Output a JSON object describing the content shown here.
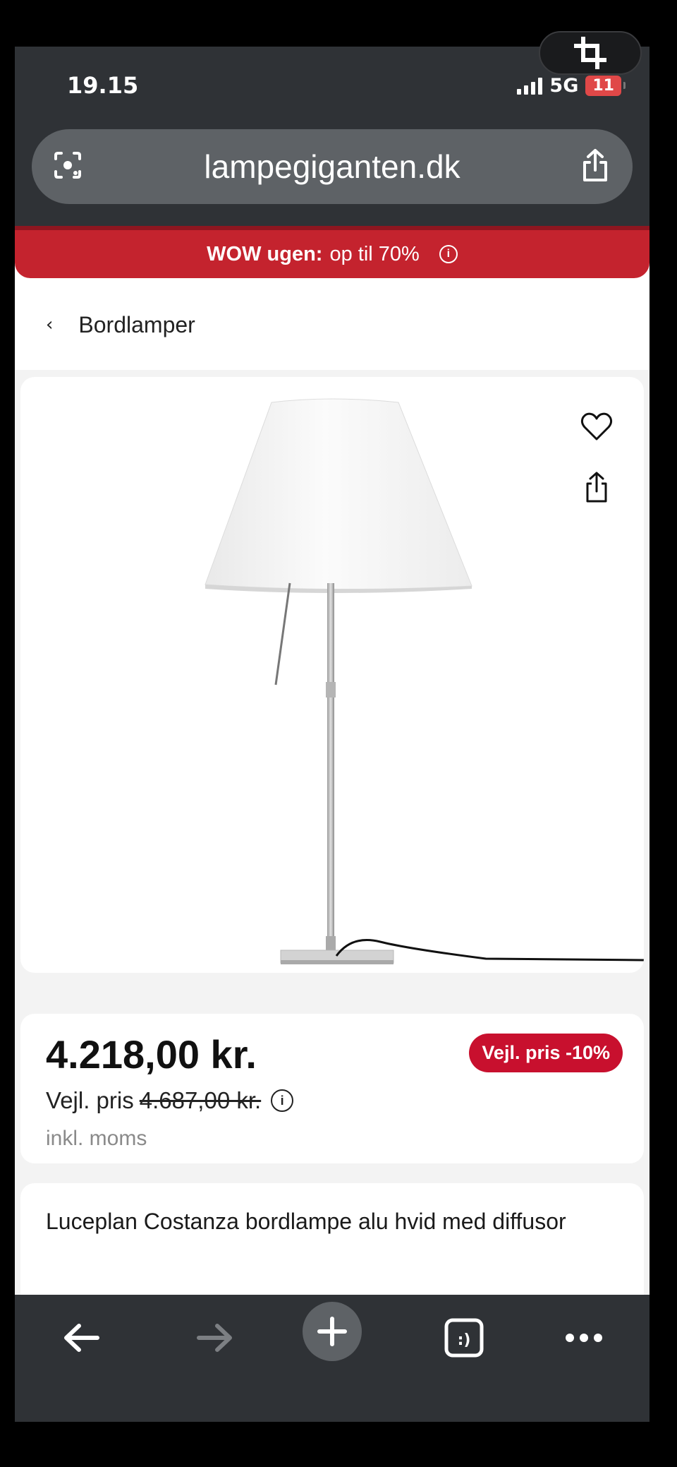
{
  "status_bar": {
    "time": "19.15",
    "network": "5G",
    "battery": "11"
  },
  "browser": {
    "url": "lampegiganten.dk",
    "icons": {
      "lens": "camera-search-icon",
      "share": "share-icon"
    }
  },
  "promo": {
    "bold": "WOW ugen:",
    "text": "op til 70%",
    "info": "i"
  },
  "breadcrumb": {
    "chevron": "‹",
    "label": "Bordlamper"
  },
  "product": {
    "price": "4.218,00 kr.",
    "rrp_label": "Vejl. pris",
    "rrp_old": "4.687,00 kr.",
    "info": "i",
    "vat": "inkl. moms",
    "badge": "Vejl. pris -10%",
    "title": "Luceplan Costanza bordlampe alu hvid med diffusor"
  },
  "actions": {
    "favorite": "heart-icon",
    "share": "share-icon"
  },
  "bottom_bar": {
    "items": [
      "back-arrow-icon",
      "forward-arrow-icon",
      "new-tab-plus-icon",
      "tabs-icon",
      "more-icon"
    ],
    "tabs_label": ":)"
  },
  "colors": {
    "chrome": "#2f3236",
    "promo": "#c4232e",
    "badge": "#c8102e"
  }
}
